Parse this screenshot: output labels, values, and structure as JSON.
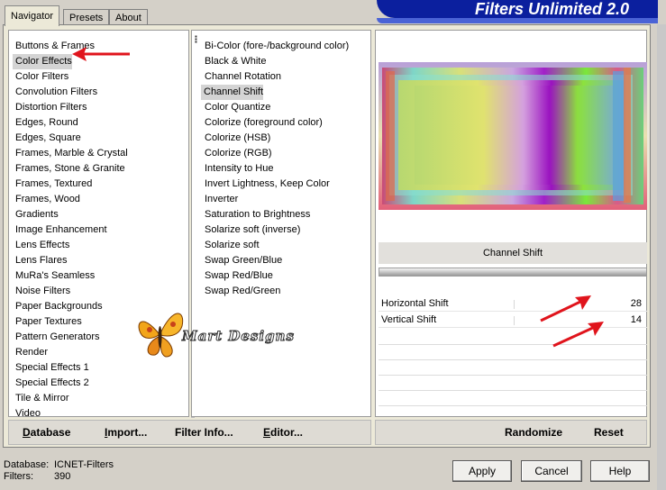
{
  "window": {
    "banner_title": "Filters Unlimited 2.0"
  },
  "tabs": [
    {
      "label": "Navigator",
      "active": true
    },
    {
      "label": "Presets",
      "active": false
    },
    {
      "label": "About",
      "active": false
    }
  ],
  "categories": {
    "items": [
      "Buttons & Frames",
      "Color Effects",
      "Color Filters",
      "Convolution Filters",
      "Distortion Filters",
      "Edges, Round",
      "Edges, Square",
      "Frames, Marble & Crystal",
      "Frames, Stone & Granite",
      "Frames, Textured",
      "Frames, Wood",
      "Gradients",
      "Image Enhancement",
      "Lens Effects",
      "Lens Flares",
      "MuRa's Seamless",
      "Noise Filters",
      "Paper Backgrounds",
      "Paper Textures",
      "Pattern Generators",
      "Render",
      "Special Effects 1",
      "Special Effects 2",
      "Tile & Mirror",
      "Video"
    ],
    "selected_index": 1
  },
  "filters": {
    "items": [
      "Bi-Color (fore-/background color)",
      "Black & White",
      "Channel Rotation",
      "Channel Shift",
      "Color Quantize",
      "Colorize (foreground color)",
      "Colorize (HSB)",
      "Colorize (RGB)",
      "Intensity to Hue",
      "Invert Lightness, Keep Color",
      "Inverter",
      "Saturation to Brightness",
      "Solarize soft (inverse)",
      "Solarize soft",
      "Swap Green/Blue",
      "Swap Red/Blue",
      "Swap Red/Green"
    ],
    "selected_index": 3
  },
  "filter_panel": {
    "title": "Channel Shift",
    "params": [
      {
        "name": "Horizontal Shift",
        "value": "28"
      },
      {
        "name": "Vertical Shift",
        "value": "14"
      }
    ]
  },
  "left_buttons": {
    "database": "Database",
    "import": "Import...",
    "filter_info": "Filter Info...",
    "editor": "Editor..."
  },
  "right_buttons": {
    "randomize": "Randomize",
    "reset": "Reset"
  },
  "status": {
    "database_label": "Database:",
    "database_value": "ICNET-Filters",
    "filters_label": "Filters:",
    "filters_value": "390"
  },
  "dialog_buttons": {
    "apply": "Apply",
    "cancel": "Cancel",
    "help": "Help"
  },
  "watermark": {
    "text": "Mart Designs"
  },
  "colors": {
    "arrow": "#e0141c",
    "banner": "#0b1f9e",
    "selection": "#d4d4d4"
  }
}
